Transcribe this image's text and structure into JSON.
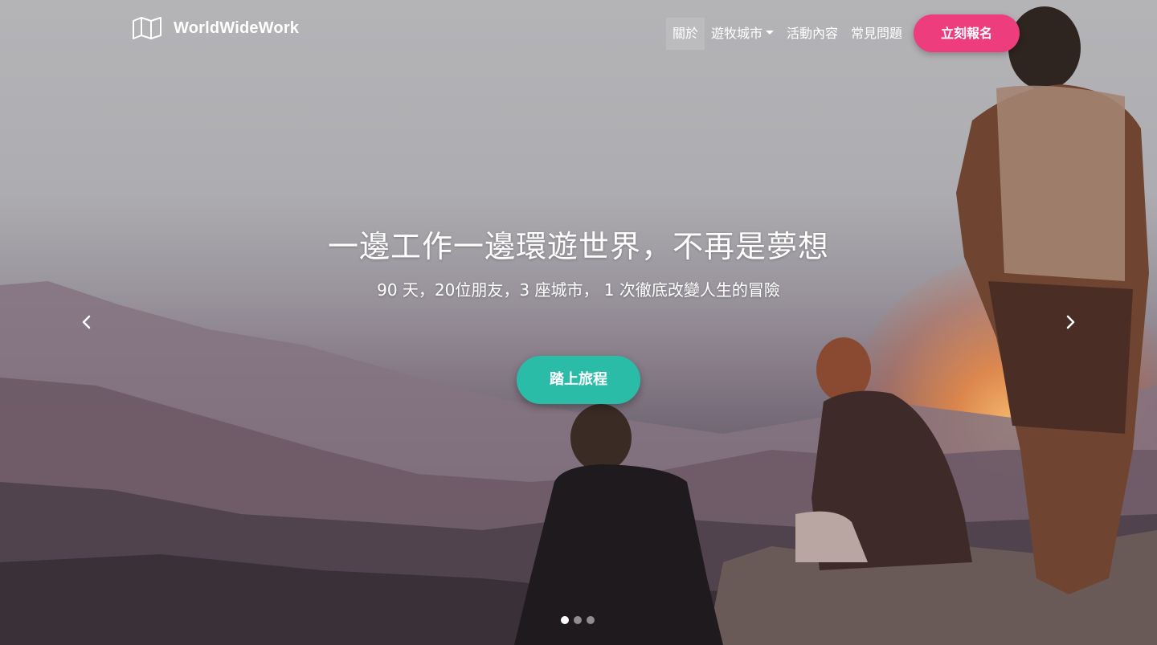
{
  "brand": {
    "name": "WorldWideWork",
    "icon": "map-icon"
  },
  "nav": {
    "items": [
      {
        "label": "關於",
        "active": true
      },
      {
        "label": "遊牧城市",
        "dropdown": true
      },
      {
        "label": "活動內容"
      },
      {
        "label": "常見問題"
      }
    ],
    "signup_label": "立刻報名"
  },
  "hero": {
    "headline": "一邊工作一邊環遊世界，不再是夢想",
    "subline": "90 天，20位朋友，3 座城市， 1 次徹底改變人生的冒險",
    "cta_label": "踏上旅程"
  },
  "carousel": {
    "prev_icon": "chevron-left-icon",
    "next_icon": "chevron-right-icon",
    "slide_count": 3,
    "active_slide": 1
  },
  "colors": {
    "signup": "#ee3d7c",
    "cta": "#2bbca8"
  }
}
